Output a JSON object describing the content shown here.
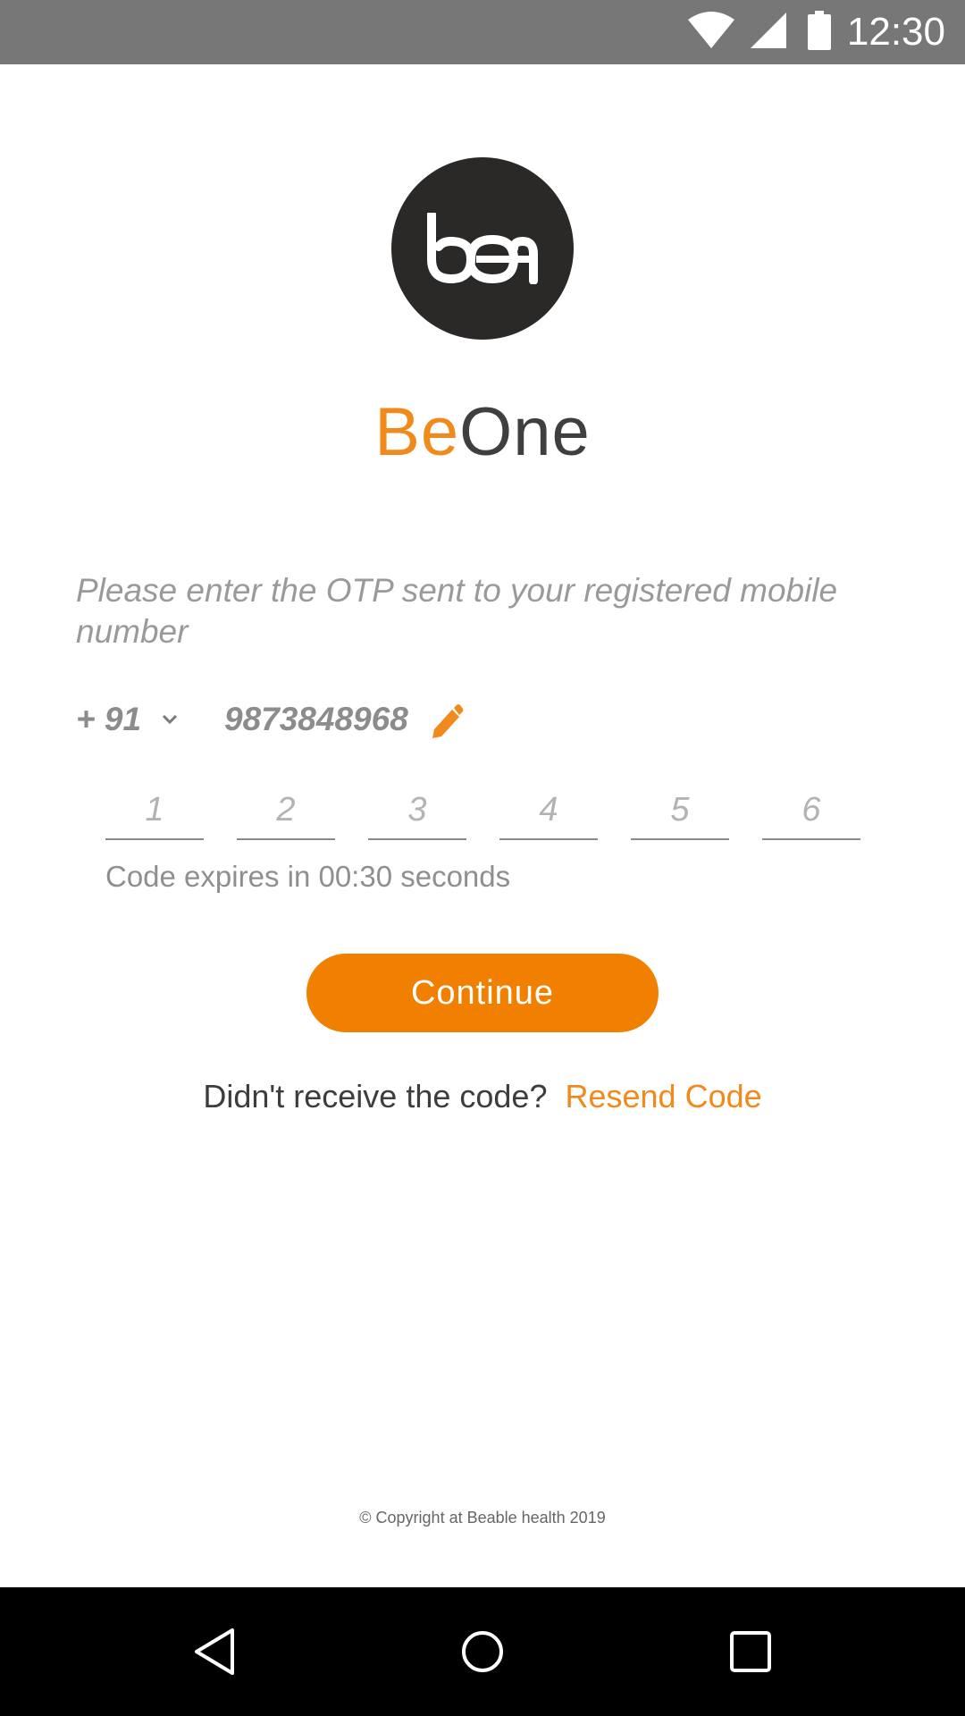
{
  "status_bar": {
    "time": "12:30",
    "icons": [
      "wifi-icon",
      "cell-signal-icon",
      "battery-icon"
    ]
  },
  "logo": {
    "icon": "beone-logo-icon"
  },
  "brand": {
    "part1": "Be",
    "part2": "One",
    "accent_color": "#f08a1c"
  },
  "instruction": "Please enter the OTP sent to your registered mobile number",
  "phone": {
    "country_code": "+ 91",
    "number": "9873848968",
    "edit_icon": "pencil-icon"
  },
  "otp": {
    "placeholders": [
      "1",
      "2",
      "3",
      "4",
      "5",
      "6"
    ]
  },
  "expiry_text": "Code expires in 00:30 seconds",
  "continue_label": "Continue",
  "resend": {
    "question": "Didn't receive the code?",
    "link": "Resend Code"
  },
  "copyright": "© Copyright at Beable health 2019",
  "nav": [
    "back-icon",
    "home-icon",
    "recents-icon"
  ]
}
